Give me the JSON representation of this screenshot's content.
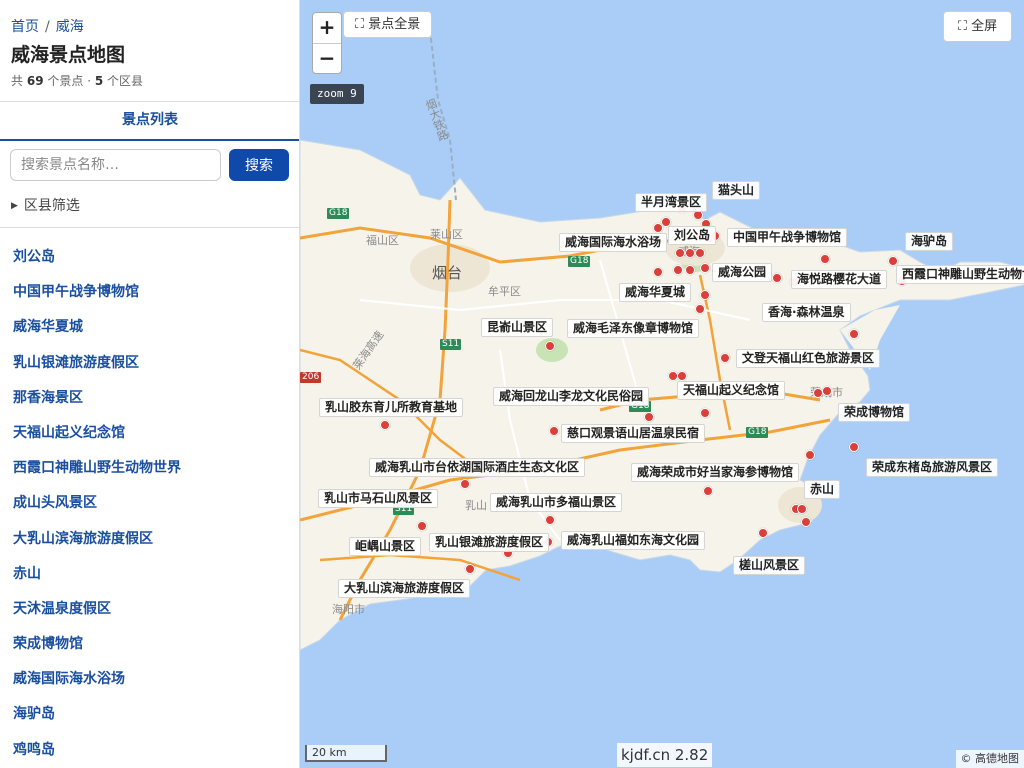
{
  "breadcrumb": {
    "home": "首页",
    "separator": "/",
    "current": "威海"
  },
  "page_title": "威海景点地图",
  "stats": {
    "prefix": "共",
    "spots": "69",
    "spots_unit": "个景点 ·",
    "districts": "5",
    "districts_unit": "个区县"
  },
  "tab": "景点列表",
  "search": {
    "placeholder": "搜索景点名称…",
    "button": "搜索"
  },
  "filter": {
    "icon": "triangle-right-icon",
    "label": "区县筛选"
  },
  "spots": [
    "刘公岛",
    "中国甲午战争博物馆",
    "威海华夏城",
    "乳山银滩旅游度假区",
    "那香海景区",
    "天福山起义纪念馆",
    "西霞口神雕山野生动物世界",
    "成山头风景区",
    "大乳山滨海旅游度假区",
    "赤山",
    "天沐温泉度假区",
    "荣成博物馆",
    "威海国际海水浴场",
    "海驴岛",
    "鸡鸣岛"
  ],
  "map": {
    "zoom_in": "+",
    "zoom_out": "−",
    "overview_button": "⛶ 景点全景",
    "fullscreen_button": "⛶ 全屏",
    "zoom_level": "zoom 9",
    "scale": "20 km",
    "watermark": "kjdf.cn 2.82",
    "attribution": "© 高德地图",
    "colors": {
      "land": "#f6f3ea",
      "sea": "#a9cdf7",
      "marker": "#db3f3a",
      "highway": "#f2a33a"
    },
    "base_labels": [
      "福山区",
      "莱山区",
      "烟台",
      "牟平区",
      "海阳市",
      "乳山",
      "荣成市",
      "威海",
      "烟大铁路",
      "莱海高速"
    ],
    "road_shields": [
      "G18",
      "G18",
      "S11",
      "G18",
      "G18",
      "S11",
      "206"
    ],
    "spot_labels": [
      "半月湾景区",
      "猫头山",
      "刘公岛",
      "威海国际海水浴场",
      "中国甲午战争博物馆",
      "海驴岛",
      "威海公园",
      "海悦路樱花大道",
      "西霞口神雕山野生动物世界",
      "威海华夏城",
      "香海·森林温泉",
      "昆嵛山景区",
      "威海毛泽东像章博物馆",
      "文登天福山红色旅游景区",
      "威海回龙山李龙文化民俗园",
      "天福山起义纪念馆",
      "乳山胶东育儿所教育基地",
      "荣成博物馆",
      "慈口观景语山居温泉民宿",
      "威海乳山市台依湖国际酒庄生态文化区",
      "荣成东楮岛旅游风景区",
      "威海荣成市好当家海参博物馆",
      "赤山",
      "乳山市马石山风景区",
      "威海乳山市多福山景区",
      "岠嵎山景区",
      "乳山银滩旅游度假区",
      "威海乳山福如东海文化园",
      "槎山风景区",
      "大乳山滨海旅游度假区"
    ]
  }
}
